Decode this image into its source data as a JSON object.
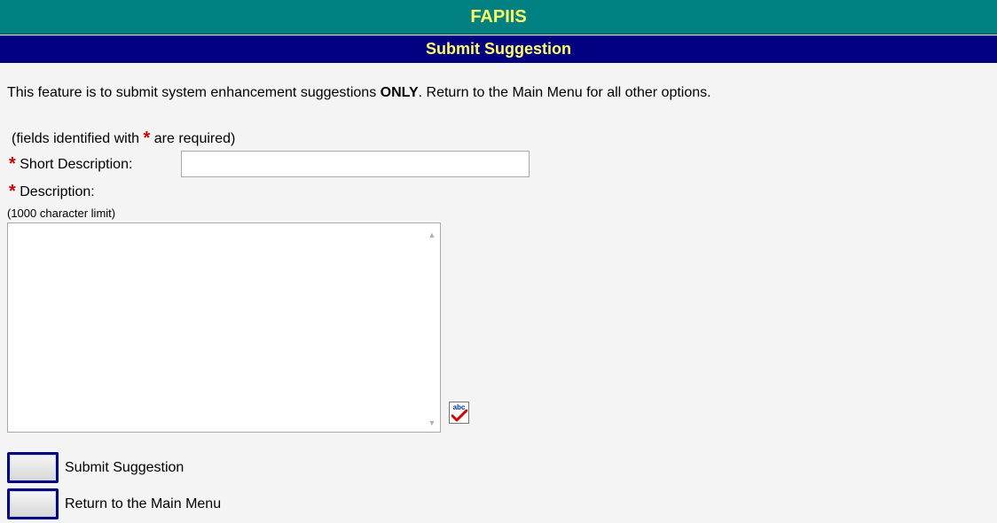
{
  "app": {
    "title": "FAPIIS"
  },
  "page": {
    "title": "Submit Suggestion"
  },
  "intro": {
    "text_before": "This feature is to submit system enhancement suggestions ",
    "text_bold": "ONLY",
    "text_after": ". Return to the Main Menu for all other options."
  },
  "form": {
    "required_note_before": "(fields identified with ",
    "required_marker": "*",
    "required_note_after": " are required)",
    "short_description": {
      "label": "Short Description:",
      "value": ""
    },
    "description": {
      "label": "Description:",
      "limit_note": "(1000 character limit)",
      "value": ""
    }
  },
  "actions": {
    "submit_label": "Submit Suggestion",
    "return_label": "Return to the Main Menu"
  },
  "icons": {
    "spellcheck": "spellcheck-icon",
    "spellcheck_text": "abc",
    "scroll_up": "scroll-up-arrow-icon",
    "scroll_down": "scroll-down-arrow-icon"
  },
  "colors": {
    "app_banner_bg": "#008080",
    "page_header_bg": "#000080",
    "header_text": "#ffff66",
    "required_star": "#cc0000",
    "page_bg": "#f4f4f4"
  }
}
